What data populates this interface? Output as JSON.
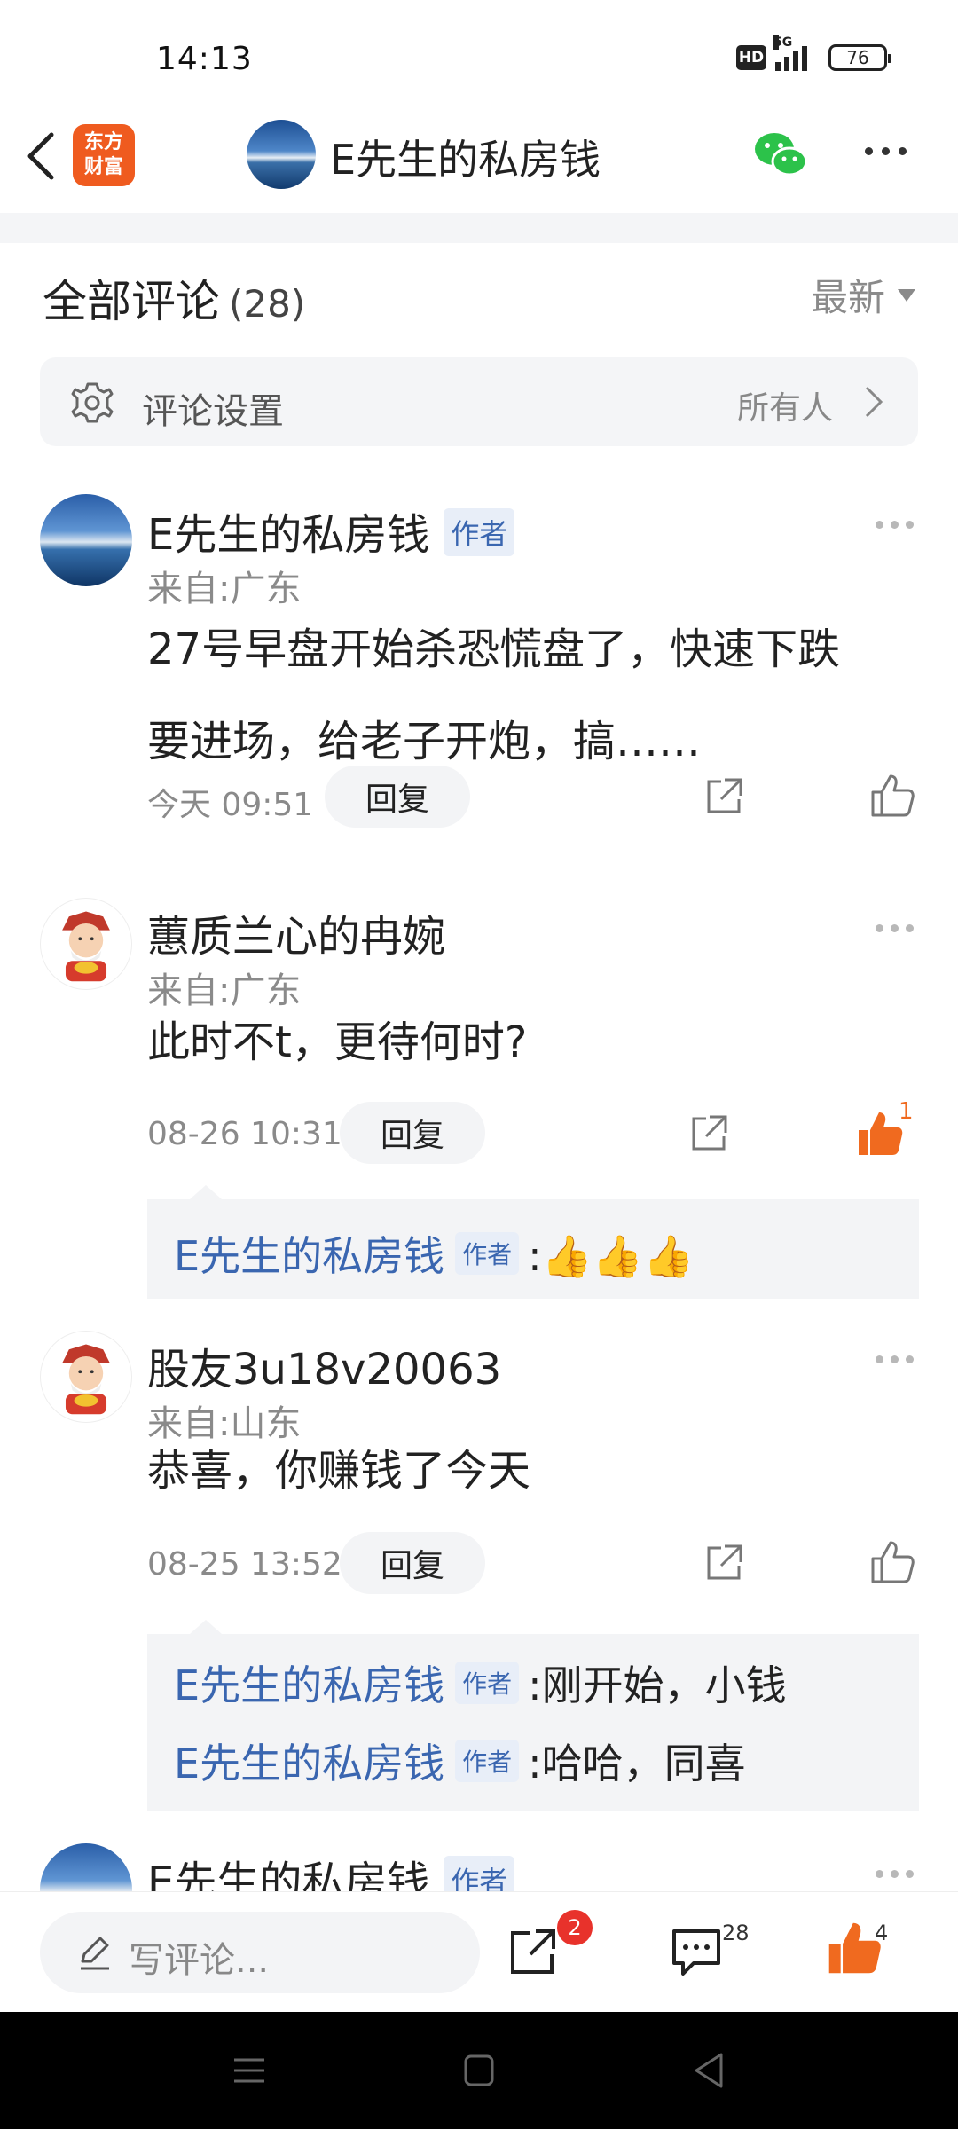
{
  "status": {
    "time": "14:13",
    "hd": "HD",
    "network": "5G",
    "battery": "76"
  },
  "header": {
    "app_logo_line1": "东方",
    "app_logo_line2": "财富",
    "title": "E先生的私房钱"
  },
  "comments_header": {
    "title": "全部评论",
    "count": "(28)",
    "sort": "最新"
  },
  "settings": {
    "label": "评论设置",
    "value": "所有人"
  },
  "comments": [
    {
      "name": "E先生的私房钱",
      "badge": "作者",
      "location": "来自:广东",
      "text_line1": "27号早盘开始杀恐慌盘了，快速下跌",
      "text_line2": "要进场，给老子开炮，搞……",
      "time": "今天 09:51",
      "reply_label": "回复",
      "likes": ""
    },
    {
      "name": "蕙质兰心的冉婉",
      "location": "来自:广东",
      "text_line1": "此时不t，更待何时?",
      "time": "08-26 10:31",
      "reply_label": "回复",
      "likes": "1",
      "replies": [
        {
          "name": "E先生的私房钱",
          "badge": "作者",
          "text": ":👍👍👍"
        }
      ]
    },
    {
      "name": "股友3u18v20063",
      "location": "来自:山东",
      "text_line1": "恭喜，你赚钱了今天",
      "time": "08-25 13:52",
      "reply_label": "回复",
      "likes": "",
      "replies": [
        {
          "name": "E先生的私房钱",
          "badge": "作者",
          "text": ":刚开始，小钱"
        },
        {
          "name": "E先生的私房钱",
          "badge": "作者",
          "text": ":哈哈，同喜"
        }
      ]
    },
    {
      "name": "E先生的私房钱",
      "badge": "作者"
    }
  ],
  "bottom": {
    "placeholder": "写评论...",
    "share_badge": "2",
    "comment_count": "28",
    "like_count": "4"
  },
  "colors": {
    "accent": "#f06a1f",
    "author_blue": "#3a66b0",
    "badge_red": "#e8322b"
  }
}
